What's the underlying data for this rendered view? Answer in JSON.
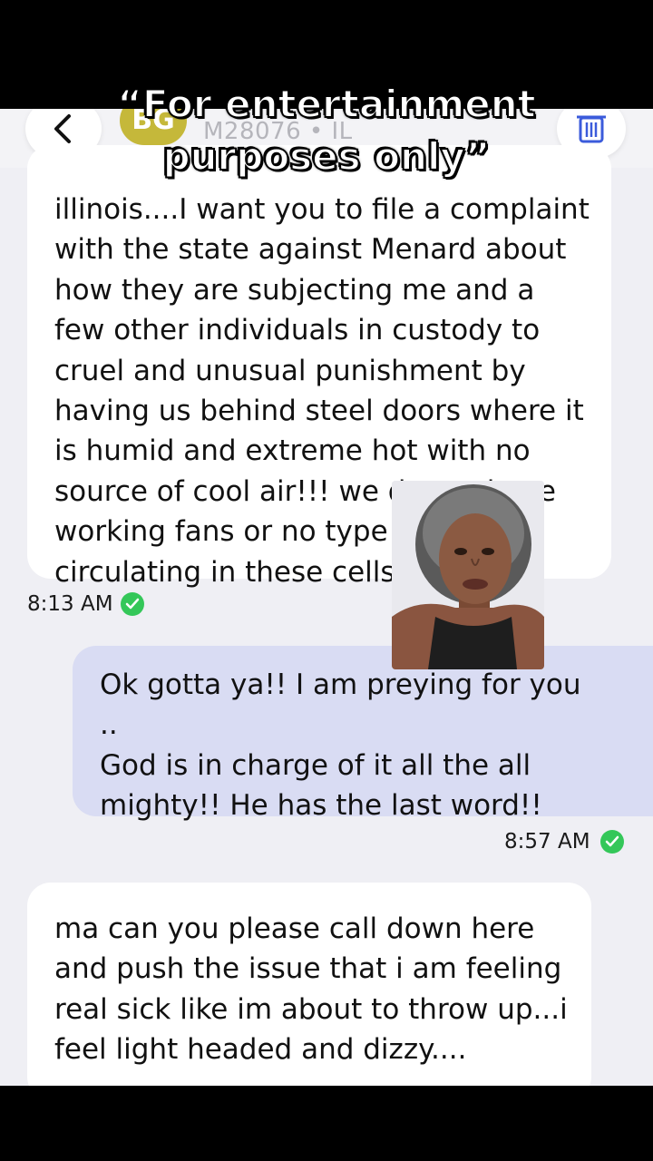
{
  "caption": {
    "line1": "“For entertainment",
    "line2": "purposes only”"
  },
  "header": {
    "avatar_initials": "BG",
    "contact_subtitle": "M28076 • IL",
    "back_icon": "chevron-left-icon",
    "trash_icon": "trash-icon"
  },
  "messages": [
    {
      "direction": "incoming",
      "text": "illinois....I want you to file a complaint\nwith the state against Menard about\nhow they are subjecting me and a\nfew other individuals in custody to\ncruel and unusual punishment by\nhaving us behind steel doors where it\nis humid and extreme hot with no\nsource of cool air!!! we do not have\nworking fans or no type of air\ncirculating in these cells....",
      "time": "8:13 AM",
      "status_icon": "check-circle-icon"
    },
    {
      "direction": "outgoing",
      "text": "Ok gotta ya!! I am preying for you ..\nGod is in charge of it all the all\nmighty!! He has the last word!!",
      "time": "8:57 AM",
      "status_icon": "check-circle-icon"
    },
    {
      "direction": "incoming",
      "text": "ma can you please call down here\nand push the issue that i am feeling\nreal sick like im about to throw up...i\nfeel light headed and dizzy....",
      "time": "",
      "status_icon": ""
    }
  ],
  "colors": {
    "screen_bg": "#efeff4",
    "incoming_bubble": "#ffffff",
    "outgoing_bubble": "#d9dcf3",
    "check_green": "#34c759",
    "trash_blue": "#3b5bdb",
    "avatar": "#c5b83a"
  }
}
